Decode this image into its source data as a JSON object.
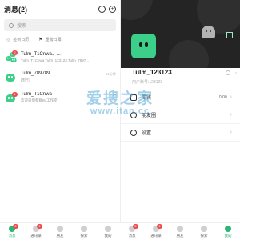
{
  "left": {
    "title": "消息(2)",
    "search_placeholder": "搜索",
    "filters": [
      {
        "label": "签到日历"
      },
      {
        "label": "重磅日幕"
      }
    ],
    "conversations": [
      {
        "name": "Tulm_T1Cnwa、...",
        "msg": "Tulm_T1Cnwa,Tulm_123123,Tulm_7897...",
        "badge": "2",
        "time": ""
      },
      {
        "name": "Tulm_789789",
        "msg": "[图片]",
        "badge": "",
        "time": "21分钟"
      },
      {
        "name": "Tulm_T1Cnwa",
        "msg": "欢迎来到蔡聊IM工作室",
        "badge": "1",
        "time": "5:49"
      }
    ]
  },
  "right": {
    "profile": {
      "name": "Tulm_123123",
      "id_label": "用户账号:123123"
    },
    "menu": [
      {
        "label": "零钱",
        "value": "0.00"
      },
      {
        "label": "朋友圈",
        "value": ""
      },
      {
        "label": "设置",
        "value": ""
      }
    ]
  },
  "watermark": {
    "line1": "爱搜之家",
    "line2": "www.itan.cc"
  },
  "tabbar_left": [
    {
      "label": "消息",
      "badge": "2",
      "active": true
    },
    {
      "label": "通讯录",
      "badge": "1",
      "active": false
    },
    {
      "label": "朋友",
      "badge": "",
      "active": false
    },
    {
      "label": "探索",
      "badge": "",
      "active": false
    },
    {
      "label": "我的",
      "badge": "",
      "active": false
    }
  ],
  "tabbar_right": [
    {
      "label": "消息",
      "badge": "2",
      "active": false
    },
    {
      "label": "通讯录",
      "badge": "1",
      "active": false
    },
    {
      "label": "朋友",
      "badge": "",
      "active": false
    },
    {
      "label": "探索",
      "badge": "",
      "active": false
    },
    {
      "label": "我的",
      "badge": "",
      "active": true
    }
  ],
  "colors": {
    "accent": "#2bb673",
    "badge": "#f04a4a",
    "avatar": "#3ccf8a",
    "cover": "#242424"
  }
}
